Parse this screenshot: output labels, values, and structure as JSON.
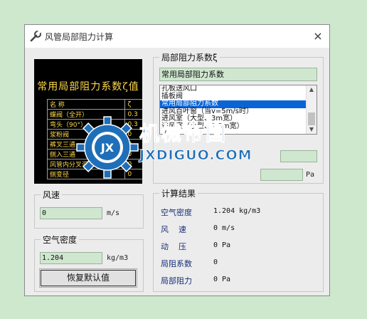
{
  "window": {
    "title": "风管局部阻力计算",
    "close_glyph": "×"
  },
  "preview": {
    "heading": "常用局部阻力系数ζ值",
    "rows": [
      [
        "名  称",
        "ζ"
      ],
      [
        "蝶阀（全开）",
        "0.3"
      ],
      [
        "弯头（90°）",
        "0.3"
      ],
      [
        "浆粉阀",
        "0"
      ],
      [
        "裤叉三通",
        "0"
      ],
      [
        "侧入三通",
        "0"
      ],
      [
        "风管内分叉调节阀",
        "0"
      ],
      [
        "侧变径",
        "0"
      ]
    ]
  },
  "coef_group": {
    "label": "局部阻力系数ξ",
    "selected_title": "常用局部阻力系数",
    "list_items": [
      "孔板送风口",
      "插板阀",
      "常用局部阻力系数",
      "进风百叶窗（当v=5m/s时）",
      "进风室（大型、3m宽）",
      "进风室（小型、1.5m宽）"
    ],
    "selected_index": 2,
    "pressure_unit": "Pa"
  },
  "speed_group": {
    "label": "风速",
    "value": "0",
    "unit": "m/s"
  },
  "density_group": {
    "label": "空气密度",
    "value": "1.204",
    "unit": "kg/m3",
    "reset_button": "恢复默认值"
  },
  "results": {
    "label": "计算结果",
    "rows": [
      {
        "name": "空气密度",
        "value": "1.204 kg/m3"
      },
      {
        "name": "风    速",
        "value": "0 m/s"
      },
      {
        "name": "动    压",
        "value": "0 Pa"
      },
      {
        "name": "局阻系数",
        "value": "0"
      },
      {
        "name": "局部阻力",
        "value": "0 Pa"
      }
    ]
  },
  "watermark": {
    "cn": "机械帝国",
    "en": "JXDIGUO.COM",
    "badge": "JX"
  },
  "colors": {
    "background": "#cde8cd",
    "field": "#cfe7cf",
    "selection": "#0a64d6",
    "result_label": "#1a2f7a",
    "preview_text": "#ffd84a",
    "watermark": "#1f6fb8"
  },
  "icons": {
    "title": "wrench-icon",
    "close": "close-icon",
    "scroll_up": "chevron-up-icon",
    "scroll_down": "chevron-down-icon",
    "watermark": "gear-logo"
  }
}
